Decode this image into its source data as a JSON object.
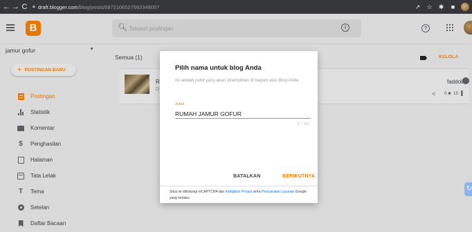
{
  "browser": {
    "nav": {
      "back": "←",
      "forward": "→",
      "reload": "C"
    },
    "url_host": "draft.blogger.com",
    "url_path": "/blog/posts/6872106527592349057"
  },
  "header": {
    "logo": "B",
    "search_placeholder": "Telusuri postingan",
    "info_icon": "i",
    "help_icon": "?"
  },
  "sidebar": {
    "blog_name": "jamur gofur",
    "new_post_label": "POSTINGAN BARU",
    "items": [
      {
        "label": "Postingan",
        "icon": "post-icon",
        "active": true
      },
      {
        "label": "Statistik",
        "icon": "stats-icon",
        "active": false
      },
      {
        "label": "Komentar",
        "icon": "comment-icon",
        "active": false
      },
      {
        "label": "Penghasilan",
        "icon": "dollar-icon",
        "active": false
      },
      {
        "label": "Halaman",
        "icon": "pages-icon",
        "active": false
      },
      {
        "label": "Tata Letak",
        "icon": "layout-icon",
        "active": false
      },
      {
        "label": "Tema",
        "icon": "theme-icon",
        "active": false
      },
      {
        "label": "Setelan",
        "icon": "gear-icon",
        "active": false
      },
      {
        "label": "Daftar Bacaan",
        "icon": "bookmark-icon",
        "active": false
      }
    ]
  },
  "main": {
    "filter_label": "Semua (1)",
    "manage_label": "KELOLA",
    "post": {
      "title_fragment": "R",
      "subtitle_fragment": "D",
      "author": "faddoli",
      "comments": "0",
      "views": "15"
    }
  },
  "dialog": {
    "title": "Pilih nama untuk blog Anda",
    "description": "Ini adalah judul yang akan ditampilkan di bagian atas Blog Anda.",
    "field_label": "Judul",
    "field_value": "RUMAH JAMUR GOFUR",
    "counter": "17 / 100",
    "cancel_label": "BATALKAN",
    "next_label": "BERIKUTNYA",
    "note_prefix": "Situs ini dilindungi reCAPTCHA dan ",
    "privacy_link": "Kebijakan Privasi",
    "note_middle": " serta ",
    "terms_link": "Persyaratan Layanan",
    "note_suffix": " Google yang berlaku."
  },
  "colors": {
    "accent": "#f57d00",
    "chrome_bg": "#35363a",
    "link": "#1a73e8"
  }
}
